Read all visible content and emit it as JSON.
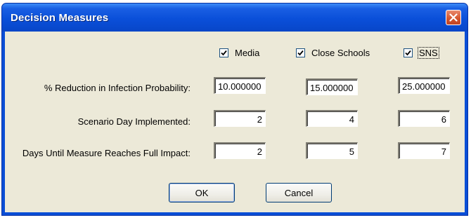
{
  "window": {
    "title": "Decision Measures"
  },
  "measures": [
    {
      "label": "Media",
      "checked": true,
      "focused": false
    },
    {
      "label": "Close Schools",
      "checked": true,
      "focused": false
    },
    {
      "label": "SNS",
      "checked": true,
      "focused": true
    }
  ],
  "rows": [
    {
      "label": "% Reduction in Infection Probability:",
      "values": [
        "10.000000",
        "15.000000",
        "25.000000"
      ]
    },
    {
      "label": "Scenario Day Implemented:",
      "values": [
        "2",
        "4",
        "6"
      ]
    },
    {
      "label": "Days Until Measure Reaches Full Impact:",
      "values": [
        "2",
        "5",
        "7"
      ]
    }
  ],
  "buttons": {
    "ok_label": "OK",
    "cancel_label": "Cancel"
  },
  "colors": {
    "titlebar": "#0a4fd9",
    "dialog_face": "#ece9d8",
    "close_button": "#d4532b",
    "checkmark": "#21a121"
  }
}
